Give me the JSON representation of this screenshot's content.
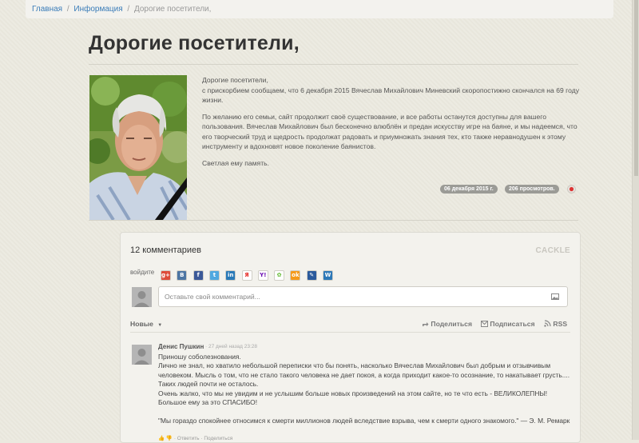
{
  "breadcrumb": {
    "home": "Главная",
    "sep1": "/",
    "section": "Информация",
    "sep2": "/",
    "current": "Дорогие посетители,"
  },
  "page_title": "Дорогие посетители,",
  "article": {
    "paragraphs": [
      "Дорогие посетители,\nс прискорбием сообщаем, что 6 декабря 2015 Вячеслав Михайлович Миневский скоропостижно скончался на 69 году жизни.",
      "По желанию его семьи, сайт продолжит своё существование, и все работы останутся доступны для вашего пользования. Вячеслав Михайлович был бесконечно влюблён и предан искусству игре на баяне, и мы надеемся, что его творческий труд и щедрость продолжат радовать и приумножать знания тех, кто также неравнодушен к этому инструменту и вдохновят новое поколение баянистов.",
      "Светлая ему память."
    ],
    "date": "06 декабря 2015 г.",
    "views": "206 просмотров."
  },
  "comments": {
    "count_label": "12 комментариев",
    "brand": "CACKLE",
    "login_label": "войдите",
    "social_icons": [
      {
        "name": "google-plus",
        "glyph": "g+",
        "color": "#dd4b39"
      },
      {
        "name": "vkontakte",
        "glyph": "B",
        "color": "#4c75a3"
      },
      {
        "name": "facebook",
        "glyph": "f",
        "color": "#3b5998"
      },
      {
        "name": "twitter",
        "glyph": "t",
        "color": "#4fa8e0"
      },
      {
        "name": "linkedin",
        "glyph": "in",
        "color": "#2a7ab8"
      },
      {
        "name": "yandex",
        "glyph": "Я",
        "color": "#ffffff",
        "fg": "#e52620"
      },
      {
        "name": "yahoo",
        "glyph": "Y!",
        "color": "#ffffff",
        "fg": "#6b0fb3"
      },
      {
        "name": "icq",
        "glyph": "✿",
        "color": "#ffffff",
        "fg": "#5fb82f"
      },
      {
        "name": "odnoklassniki",
        "glyph": "ok",
        "color": "#f59a1a"
      },
      {
        "name": "livejournal",
        "glyph": "✎",
        "color": "#2a5a9c"
      },
      {
        "name": "wordpress",
        "glyph": "W",
        "color": "#2c78b8"
      }
    ],
    "input_placeholder": "Оставьте свой комментарий...",
    "sort_label": "Новые",
    "share_label": "Поделиться",
    "subscribe_label": "Подписаться",
    "rss_label": "RSS",
    "items": [
      {
        "author": "Денис Пушкин",
        "time": "· 27 дней назад 23:28",
        "lines": [
          "Приношу соболезнования.",
          "Лично не знал, но хватило небольшой переписки что бы понять, насколько Вячеслав Михайлович был добрым и отзывчивым человеком. Мысль о том, что не стало такого человека не дает покоя, а когда приходит какое-то осознание, то накатывает грусть.... Таких людей почти не осталось.",
          "Очень жалко, что мы не увидим и не услышим больше новых произведений на этом сайте, но те что есть - ВЕЛИКОЛЕПНЫ! Большое ему за это СПАСИБО!",
          "",
          "\"Мы гораздо спокойнее относимся к смерти миллионов людей вследствие взрыва, чем к смерти одного знакомого.\" — Э. М. Ремарк"
        ],
        "reply_label": "· Ответить",
        "share_label": "· Поделиться"
      }
    ]
  }
}
